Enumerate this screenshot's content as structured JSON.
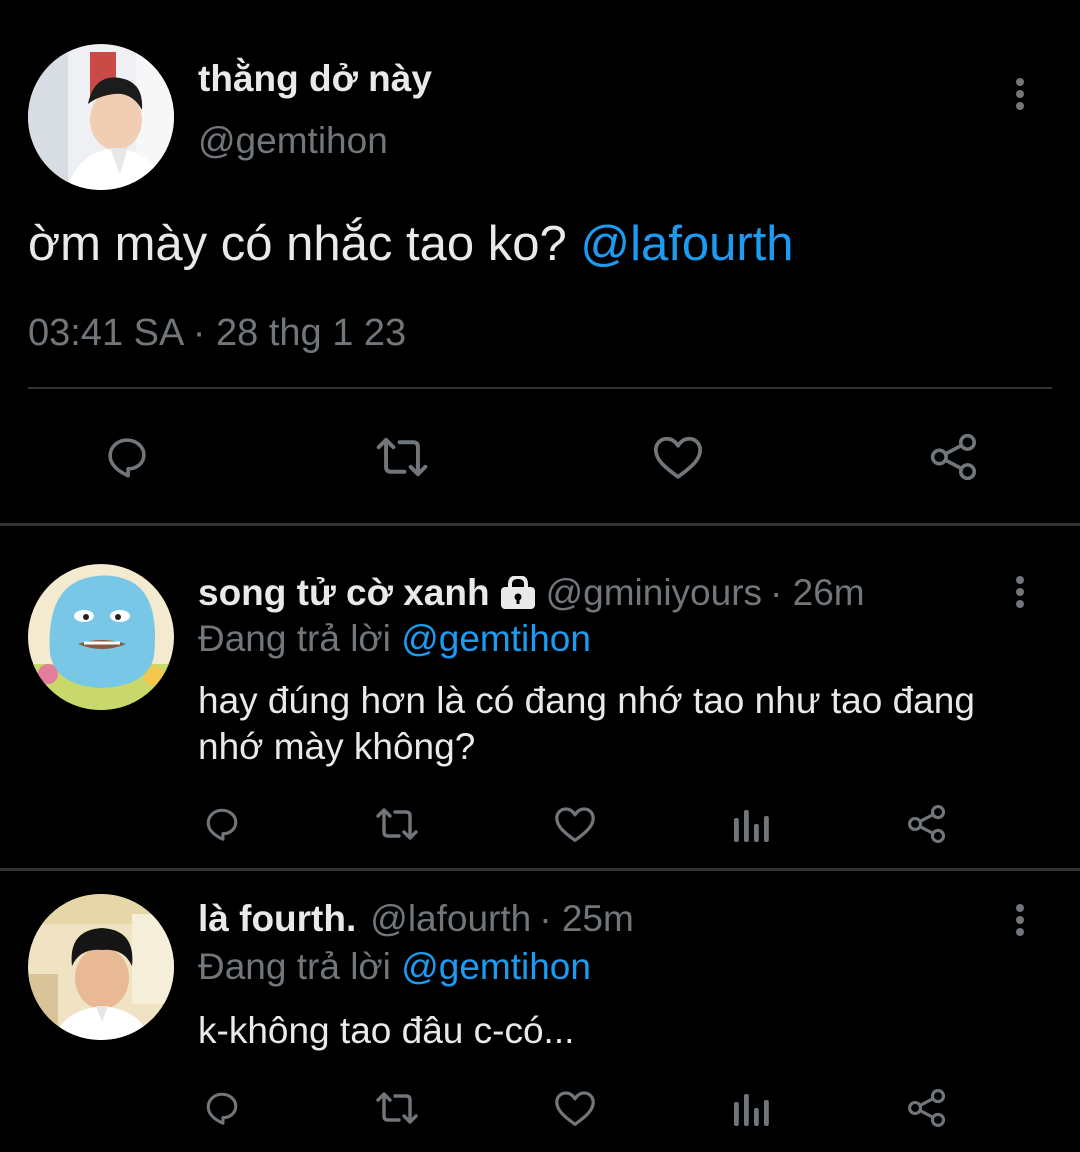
{
  "main_tweet": {
    "display_name": "thằng dở này",
    "handle": "@gemtihon",
    "text": "ờm mày có nhắc tao ko?",
    "mention": "@lafourth",
    "timestamp": "03:41 SA · 28 thg 1 23",
    "actions": [
      "reply-icon",
      "retweet-icon",
      "like-icon",
      "share-icon"
    ]
  },
  "replies": [
    {
      "display_name": "song tử cờ xanh",
      "protected": true,
      "handle": "@gminiyours",
      "time": "· 26m",
      "replying_prefix": "Đang trả lời",
      "replying_to": "@gemtihon",
      "text": "hay đúng hơn là có đang nhớ tao như tao đang nhớ mày không?"
    },
    {
      "display_name": "là fourth.",
      "protected": false,
      "handle": "@lafourth",
      "time": "· 25m",
      "replying_prefix": "Đang trả lời",
      "replying_to": "@gemtihon",
      "text": "k-không tao đâu c-có..."
    }
  ],
  "colors": {
    "background": "#000000",
    "text": "#e7e9ea",
    "secondary": "#71767b",
    "accent": "#1d9bf0",
    "divider": "#2f3336"
  }
}
